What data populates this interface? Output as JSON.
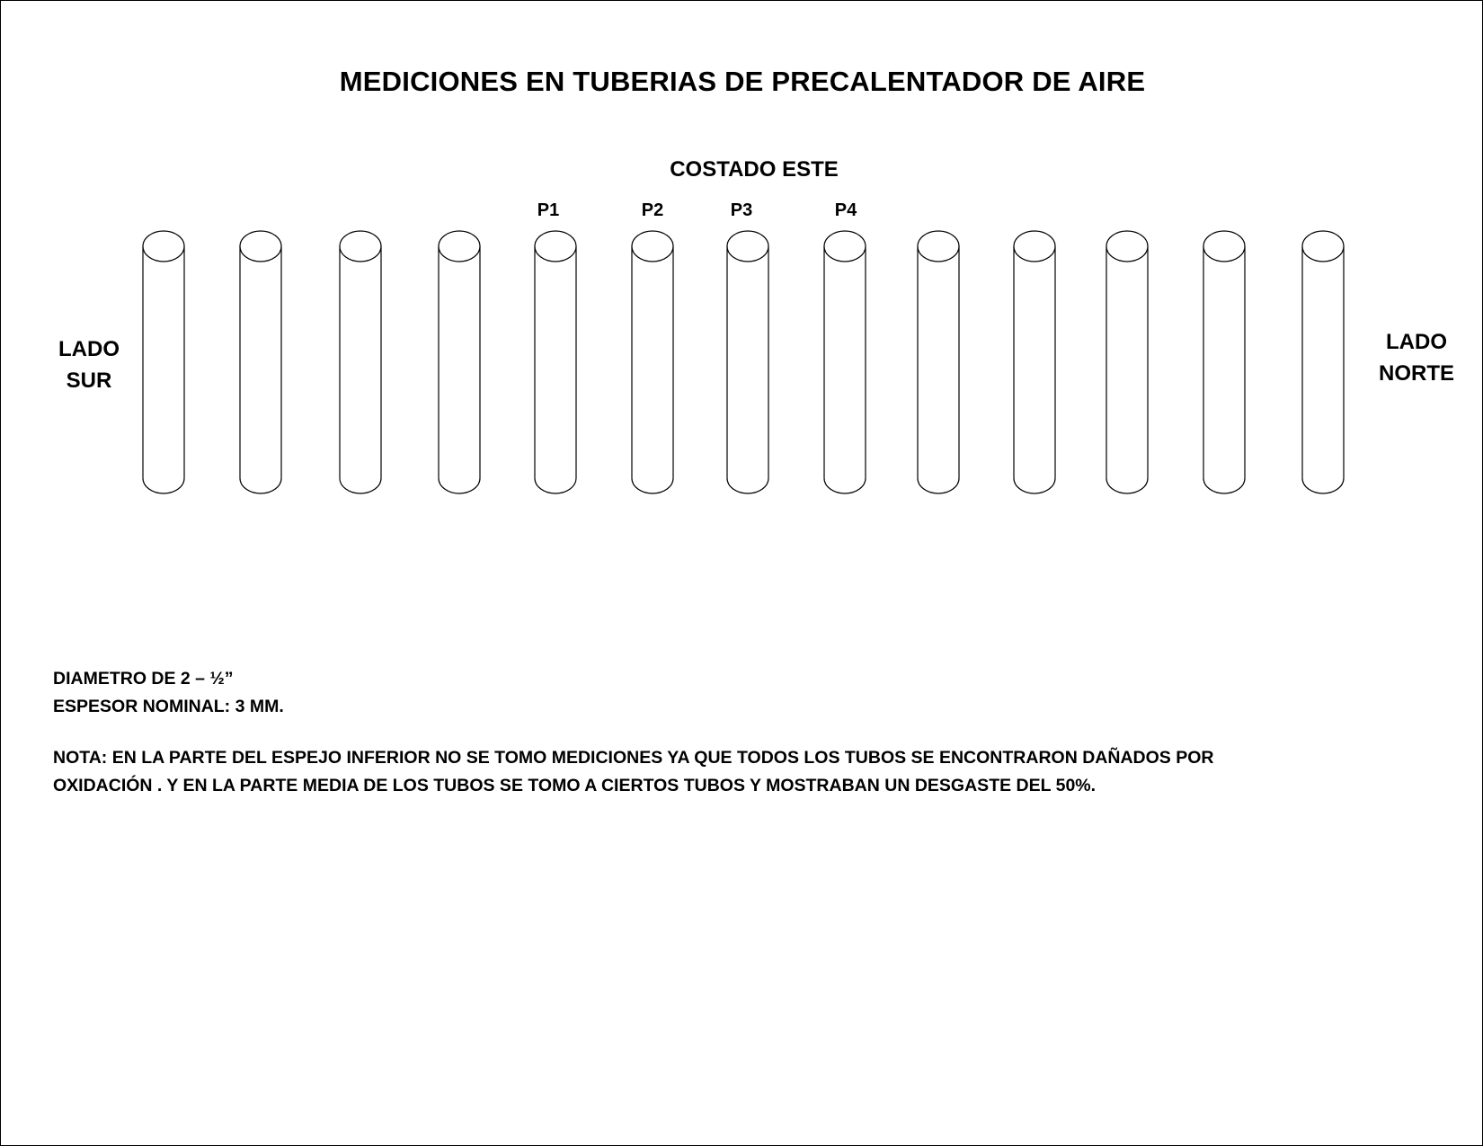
{
  "title": "MEDICIONES EN TUBERIAS DE PRECALENTADOR DE AIRE",
  "subtitle": "COSTADO ESTE",
  "side_left": {
    "line1": "LADO",
    "line2": "SUR"
  },
  "side_right": {
    "line1": "LADO",
    "line2": "NORTE"
  },
  "points": [
    "P1",
    "P2",
    "P3",
    "P4"
  ],
  "tubes": {
    "count": 13,
    "stroke": "#000000"
  },
  "notes": {
    "diameter": "DIAMETRO DE 2 – ½”",
    "thickness": "ESPESOR NOMINAL: 3 MM.",
    "nota_line1": "NOTA: EN LA PARTE DEL ESPEJO INFERIOR NO SE TOMO MEDICIONES YA QUE TODOS LOS TUBOS SE ENCONTRARON DAÑADOS POR",
    "nota_line2": "OXIDACIÓN . Y EN LA PARTE MEDIA DE LOS TUBOS SE TOMO A CIERTOS TUBOS Y MOSTRABAN UN DESGASTE DEL 50%."
  }
}
